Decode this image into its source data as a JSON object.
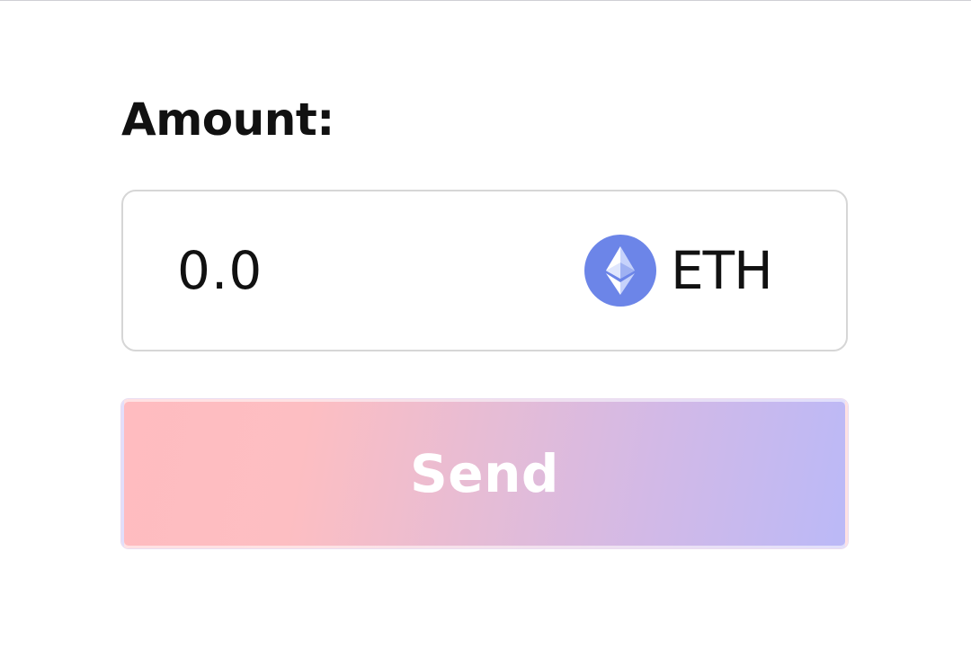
{
  "form": {
    "amount_label": "Amount:",
    "amount_input": {
      "value": "",
      "placeholder": "0.0"
    },
    "token": {
      "icon": "ethereum-icon",
      "symbol": "ETH",
      "icon_color": "#6c85e8"
    },
    "send_button": {
      "label": "Send",
      "gradient_start": "#ffbcc0",
      "gradient_end": "#bbb9f7"
    }
  }
}
